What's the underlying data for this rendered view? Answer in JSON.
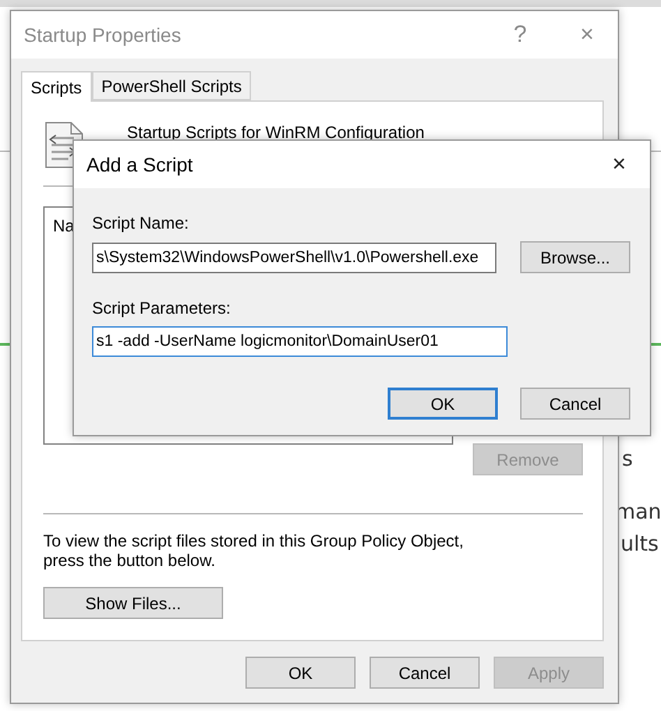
{
  "background_window": {
    "fragments": [
      "s",
      "man",
      "ults"
    ]
  },
  "properties_window": {
    "title": "Startup Properties",
    "help": "?",
    "close": "×",
    "tabs": [
      {
        "label": "Scripts",
        "selected": true
      },
      {
        "label": "PowerShell Scripts",
        "selected": false
      }
    ],
    "heading": "Startup Scripts for WinRM Configuration",
    "list_header": "Na",
    "remove_button": {
      "label": "Remove",
      "disabled": true
    },
    "info_text": "To view the script files stored in this Group Policy Object, press the button below.",
    "show_files_button": "Show Files...",
    "buttons": [
      {
        "label": "OK",
        "disabled": false
      },
      {
        "label": "Cancel",
        "disabled": false
      },
      {
        "label": "Apply",
        "disabled": true
      }
    ]
  },
  "add_script_dialog": {
    "title": "Add a Script",
    "close": "×",
    "script_name": {
      "label": "Script Name:",
      "value": "s\\System32\\WindowsPowerShell\\v1.0\\Powershell.exe",
      "focused": false
    },
    "browse_button": "Browse...",
    "script_parameters": {
      "label": "Script Parameters:",
      "value": "s1 -add -UserName logicmonitor\\DomainUser01",
      "focused": true
    },
    "buttons": [
      {
        "label": "OK",
        "default": true
      },
      {
        "label": "Cancel",
        "default": false
      }
    ]
  }
}
